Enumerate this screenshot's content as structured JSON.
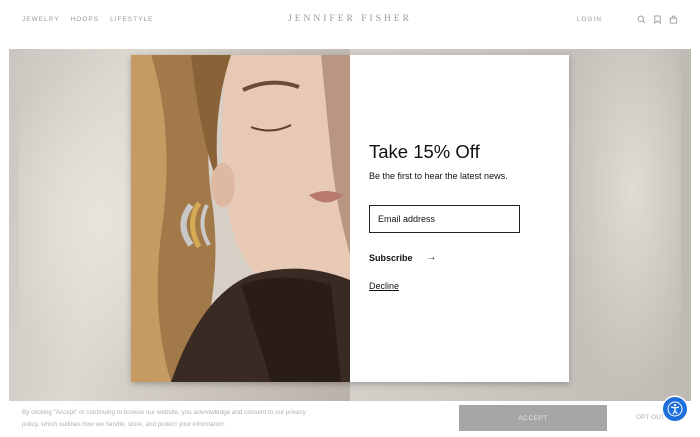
{
  "header": {
    "nav": [
      {
        "label": "JEWELRY"
      },
      {
        "label": "HOOPS"
      },
      {
        "label": "LIFESTYLE"
      }
    ],
    "brand": "JENNIFER FISHER",
    "login_label": "LOGIN",
    "icons": [
      "search-icon",
      "bookmark-icon",
      "bag-icon"
    ]
  },
  "modal": {
    "title": "Take 15% Off",
    "subtitle": "Be the first to hear the latest news.",
    "email_placeholder": "Email address",
    "subscribe_label": "Subscribe",
    "arrow": "→",
    "decline_label": "Decline"
  },
  "cookie_bar": {
    "text": "By clicking \"Accept\" or continuing to browse our website, you acknowledge and consent to our privacy policy, which outlines how we handle, store, and protect your information.",
    "accept_label": "ACCEPT",
    "opt_out_label": "OPT OUT"
  },
  "colors": {
    "accept_button": "#a6a6a6",
    "accessibility_button": "#1e6fd9",
    "nav_text": "#9a9a9a"
  }
}
